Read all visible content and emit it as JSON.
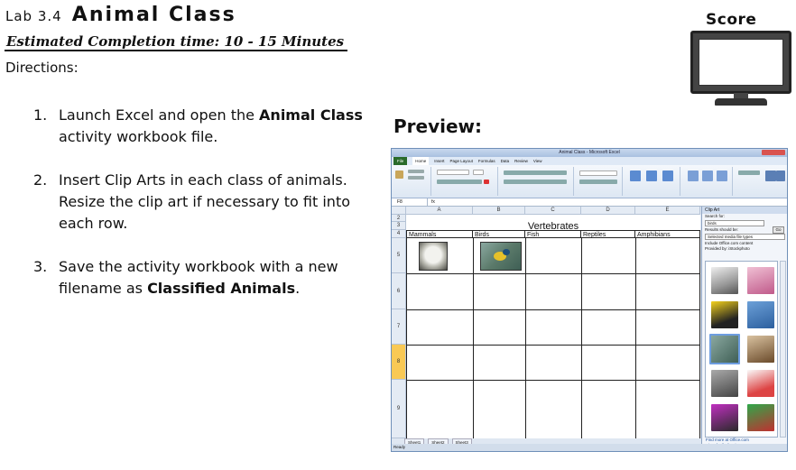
{
  "header": {
    "lab_number": "Lab 3.4",
    "lab_name": "Animal Class",
    "estimated_time": "Estimated Completion time: 10 - 15 Minutes",
    "directions_label": "Directions:"
  },
  "steps": [
    {
      "num": "1.",
      "pre": "Launch Excel and open the ",
      "bold": "Animal Class",
      "post": " activity workbook file."
    },
    {
      "num": "2.",
      "pre": "Insert Clip Arts in each class of animals. Resize the clip art if necessary to fit into each row.",
      "bold": "",
      "post": ""
    },
    {
      "num": "3.",
      "pre": "Save the activity workbook with a new filename as ",
      "bold": "Classified Animals",
      "post": "."
    }
  ],
  "score": {
    "label": "Score"
  },
  "preview": {
    "label": "Preview:"
  },
  "excel": {
    "window_title": "Animal Class - Microsoft Excel",
    "ribbon_tabs": [
      "File",
      "Home",
      "Insert",
      "Page Layout",
      "Formulas",
      "Data",
      "Review",
      "View"
    ],
    "name_box": "F8",
    "fx": "fx",
    "columns": [
      "A",
      "B",
      "C",
      "D",
      "E"
    ],
    "rows": [
      "2",
      "3",
      "4",
      "5",
      "6",
      "7",
      "8",
      "9"
    ],
    "sheet_title": "Vertebrates",
    "class_headers": [
      "Mammals",
      "Birds",
      "Fish",
      "Reptiles",
      "Amphibians"
    ],
    "sheet_tabs": [
      "Sheet1",
      "Sheet2",
      "Sheet3"
    ],
    "status": "Ready",
    "clip_art": {
      "pane_title": "Clip Art",
      "search_label": "Search for:",
      "search_value": "birds",
      "go_label": "Go",
      "results_label": "Results should be:",
      "results_value": "Selected media file types",
      "include_label": "Include Office.com content",
      "provided_by": "Provided by: iStockphoto",
      "link_1": "Find more at Office.com",
      "link_2": "Hints for finding images"
    }
  },
  "colors": {
    "selected_row": "#f9c955",
    "file_tab": "#2a6b2a",
    "window_border": "#6f8fb8"
  }
}
